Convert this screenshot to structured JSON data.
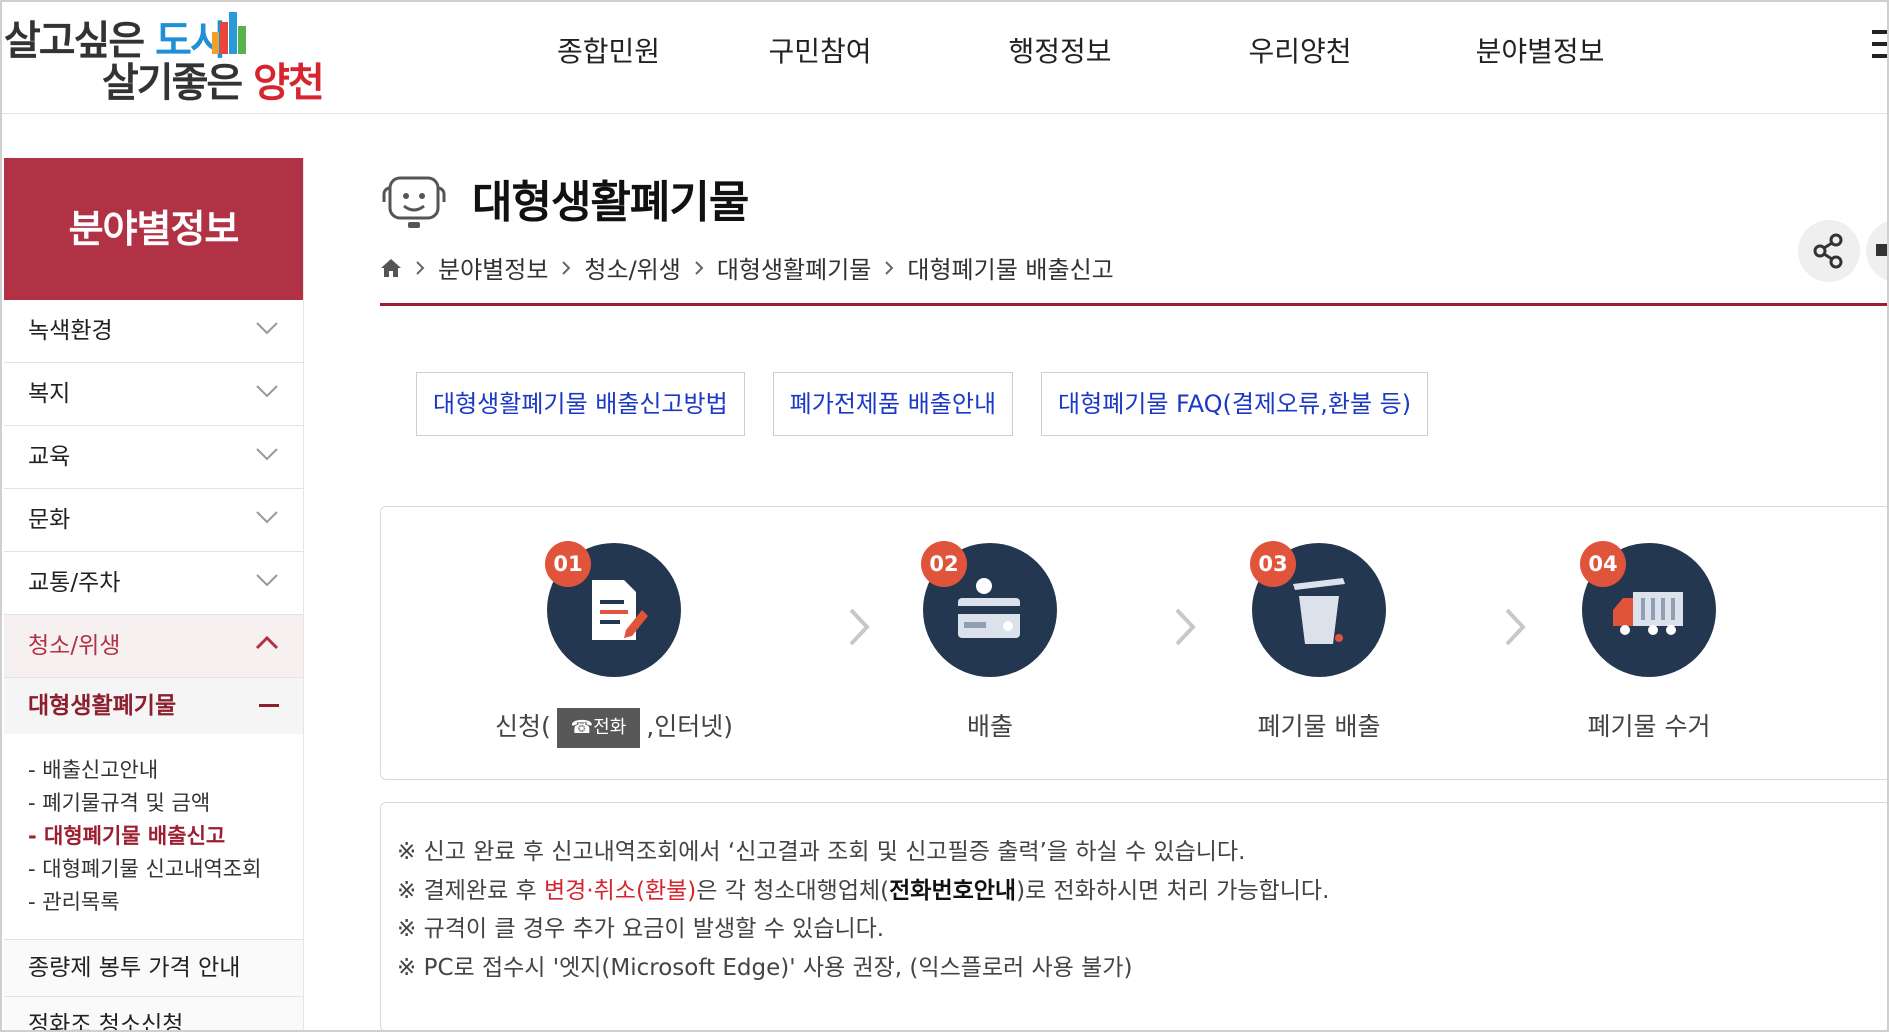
{
  "header": {
    "logo_line1_a": "살고싶은 ",
    "logo_line1_b": "도시",
    "logo_line2_a": "살기좋은 ",
    "logo_line2_b": "양천",
    "nav": [
      "종합민원",
      "구민참여",
      "행정정보",
      "우리양천",
      "분야별정보"
    ]
  },
  "sidebar": {
    "title": "분야별정보",
    "items": [
      "녹색환경",
      "복지",
      "교육",
      "문화",
      "교통/주차"
    ],
    "active_item": "청소/위생",
    "sub_title": "대형생활폐기물",
    "sub_items": [
      "- 배출신고안내",
      "- 폐기물규격 및 금액",
      "- 대형폐기물 배출신고",
      "- 대형폐기물 신고내역조회",
      "- 관리목록"
    ],
    "active_sub_index": 2,
    "extra_items": [
      "종량제 봉투 가격 안내",
      "정화조 청소신청"
    ]
  },
  "page": {
    "title": "대형생활폐기물",
    "breadcrumb": [
      "분야별정보",
      "청소/위생",
      "대형생활폐기물",
      "대형폐기물 배출신고"
    ]
  },
  "links": [
    "대형생활폐기물 배출신고방법",
    "폐가전제품 배출안내",
    "대형폐기물 FAQ(결제오류,환불 등)"
  ],
  "steps": [
    {
      "num": "01",
      "label_before": "신청(",
      "badge": "☎전화",
      "label_after": ",인터넷)",
      "icon": "form-icon"
    },
    {
      "num": "02",
      "label": "배출",
      "icon": "card-icon"
    },
    {
      "num": "03",
      "label": "폐기물 배출",
      "icon": "trash-icon"
    },
    {
      "num": "04",
      "label": "폐기물 수거",
      "icon": "truck-icon"
    }
  ],
  "notes": {
    "n1": "※ 신고 완료 후 신고내역조회에서 ‘신고결과 조회 및 신고필증 출력’을 하실 수 있습니다.",
    "n2_a": "※ 결제완료 후 ",
    "n2_red": "변경·취소(환불)",
    "n2_b": "은 각 청소대행업체(",
    "n2_bold": "전화번호안내",
    "n2_c": ")로 전화하시면 처리 가능합니다.",
    "n3": "※ 규격이 클 경우 추가 요금이 발생할 수 있습니다.",
    "n4": "※ PC로 접수시 '엣지(Microsoft Edge)' 사용 권장, (익스플로러 사용 불가)"
  },
  "colors": {
    "brand_red": "#b13245",
    "link_blue": "#1c39c6",
    "step_navy": "#233750",
    "step_orange": "#e1543c"
  }
}
